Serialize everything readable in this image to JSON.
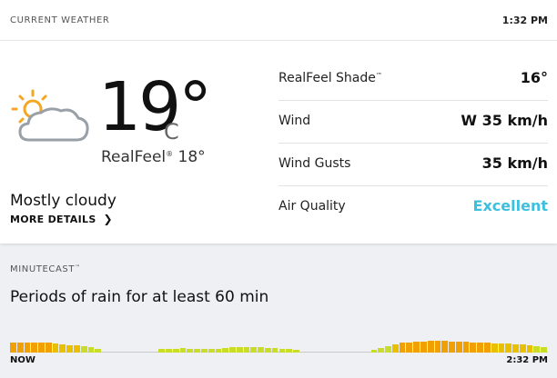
{
  "header": {
    "title": "CURRENT WEATHER",
    "time": "1:32 PM"
  },
  "current": {
    "icon": "partly-cloudy-icon",
    "temperature": "19°",
    "unit": "C",
    "realfeel_label": "RealFeel",
    "realfeel_mark": "®",
    "realfeel_value": "18°",
    "phrase": "Mostly cloudy",
    "more_details": "MORE DETAILS"
  },
  "details": [
    {
      "label": "RealFeel Shade",
      "mark": "™",
      "value": "16°"
    },
    {
      "label": "Wind",
      "mark": "",
      "value": "W 35 km/h"
    },
    {
      "label": "Wind Gusts",
      "mark": "",
      "value": "35 km/h"
    },
    {
      "label": "Air Quality",
      "mark": "",
      "value": "Excellent"
    }
  ],
  "minutecast": {
    "title": "MINUTECAST",
    "mark": "™",
    "phrase": "Periods of rain for at least 60 min",
    "start_label": "NOW",
    "end_label": "2:32 PM",
    "intensity": [
      0.55,
      0.55,
      0.55,
      0.55,
      0.55,
      0.55,
      0.5,
      0.45,
      0.4,
      0.4,
      0.35,
      0.3,
      0.2,
      0,
      0,
      0,
      0,
      0,
      0,
      0,
      0,
      0.2,
      0.2,
      0.2,
      0.25,
      0.2,
      0.2,
      0.2,
      0.2,
      0.2,
      0.25,
      0.3,
      0.3,
      0.3,
      0.3,
      0.3,
      0.25,
      0.25,
      0.2,
      0.2,
      0.15,
      0,
      0,
      0,
      0,
      0,
      0,
      0,
      0,
      0,
      0,
      0.15,
      0.25,
      0.35,
      0.45,
      0.55,
      0.55,
      0.6,
      0.6,
      0.65,
      0.65,
      0.65,
      0.6,
      0.6,
      0.6,
      0.55,
      0.55,
      0.55,
      0.5,
      0.5,
      0.5,
      0.45,
      0.45,
      0.4,
      0.35,
      0.3
    ]
  },
  "colors": {
    "accent": "#3cc0dd",
    "rain_light": "#c8dc28",
    "rain_medium": "#e8c000",
    "rain_heavy": "#f0a000",
    "sun": "#f5a623",
    "cloud": "#9aa0a8"
  }
}
